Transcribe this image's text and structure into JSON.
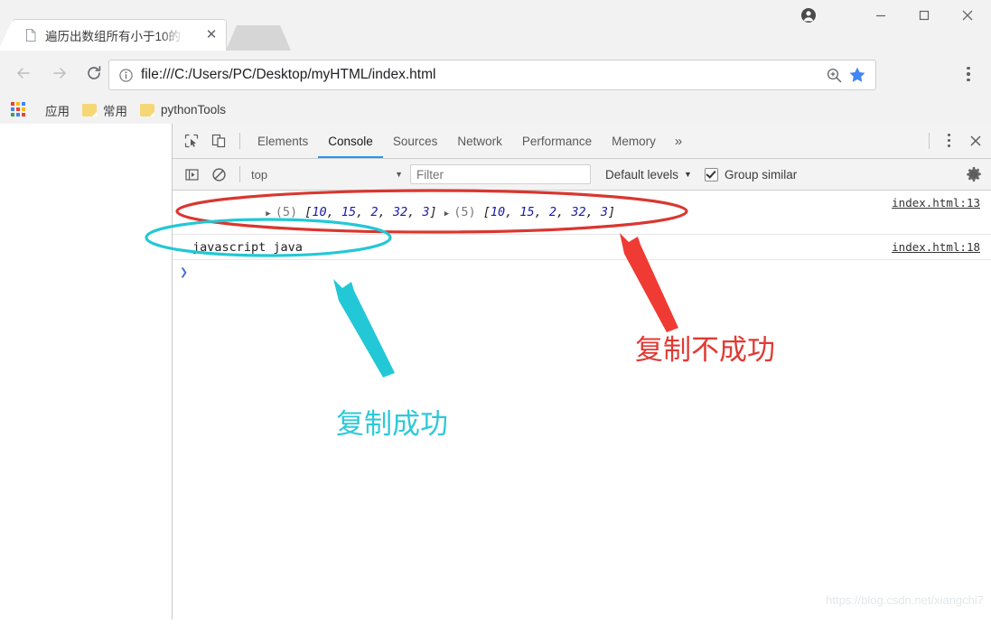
{
  "browser": {
    "tab": {
      "title": "遍历出数组所有小于10的",
      "favicon_icon": "page-icon",
      "close_icon": "close-icon"
    },
    "window_controls": {
      "profile_icon": "profile-avatar-icon",
      "minimize_icon": "minimize-icon",
      "maximize_icon": "maximize-icon",
      "close_icon": "close-icon"
    },
    "toolbar": {
      "back_icon": "back-arrow-icon",
      "forward_icon": "forward-arrow-icon",
      "reload_icon": "reload-icon",
      "info_icon": "page-info-icon",
      "url": "file:///C:/Users/PC/Desktop/myHTML/index.html",
      "zoom_icon": "zoom-in-icon",
      "star_icon": "bookmark-star-icon",
      "menu_icon": "three-dot-menu-icon"
    },
    "bookmarks": {
      "apps_icon": "apps-grid-icon",
      "items": [
        {
          "label": "应用",
          "icon": "apps-grid-icon",
          "has_folder": false
        },
        {
          "label": "常用",
          "icon": "folder-icon",
          "has_folder": true
        },
        {
          "label": "pythonTools",
          "icon": "folder-icon",
          "has_folder": true
        }
      ]
    }
  },
  "devtools": {
    "left_icons": [
      {
        "name": "inspect-element-icon"
      },
      {
        "name": "device-toolbar-icon"
      }
    ],
    "tabs": [
      {
        "label": "Elements",
        "active": false
      },
      {
        "label": "Console",
        "active": true
      },
      {
        "label": "Sources",
        "active": false
      },
      {
        "label": "Network",
        "active": false
      },
      {
        "label": "Performance",
        "active": false
      },
      {
        "label": "Memory",
        "active": false
      }
    ],
    "more_tabs_label": "»",
    "vertical_dots_icon": "devtools-menu-icon",
    "close_icon": "devtools-close-icon",
    "filterbar": {
      "sidebar_toggle_icon": "console-sidebar-icon",
      "clear_icon": "clear-console-icon",
      "context": "top",
      "context_caret": "▼",
      "filter_placeholder": "Filter",
      "filter_value": "",
      "levels_label": "Default levels",
      "levels_caret": "▼",
      "group_similar_label": "Group similar",
      "group_similar_checked": true,
      "settings_icon": "gear-icon"
    },
    "console_rows": [
      {
        "type": "array-pair",
        "triangle": "▶",
        "length_label": "(5)",
        "values": [
          10,
          15,
          2,
          32,
          3
        ],
        "source": "index.html:13"
      },
      {
        "type": "text",
        "text": "javascript java",
        "source": "index.html:18"
      }
    ],
    "prompt_chevron": "❯"
  },
  "annotations": [
    {
      "text": "复制不成功",
      "color": "#e03a34",
      "name": "annotation-copy-failed"
    },
    {
      "text": "复制成功",
      "color": "#2ec9d8",
      "name": "annotation-copy-success"
    }
  ],
  "colors": {
    "accent_blue": "#2196f3",
    "red_annotation": "#e03a34",
    "cyan_annotation": "#2ec9d8",
    "array_number": "#1a1aa6",
    "star_blue": "#4285f4"
  },
  "watermark": "https://blog.csdn.net/xiangchi7"
}
